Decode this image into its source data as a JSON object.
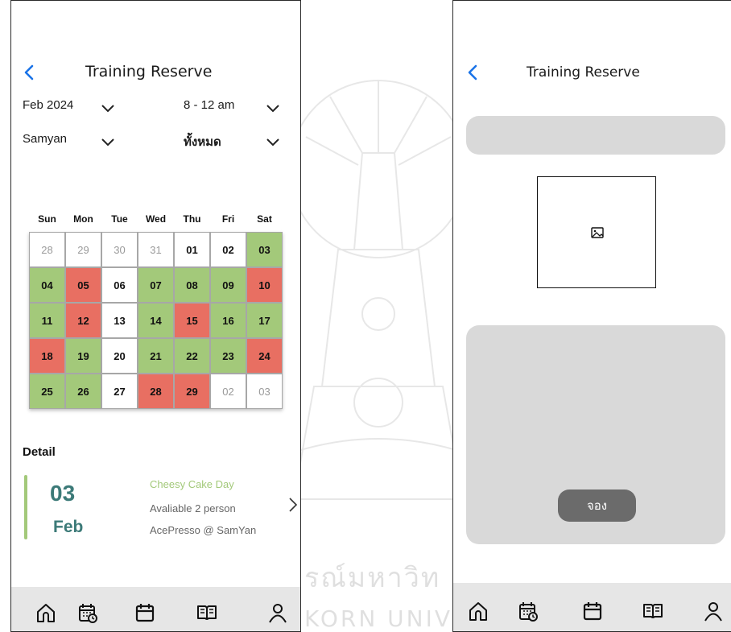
{
  "watermark": {
    "line1": "รณ์มหาวิท",
    "line2": "KORN UNIV"
  },
  "left_screen": {
    "title": "Training Reserve",
    "filters": {
      "month": "Feb 2024",
      "time": "8 - 12 am",
      "branch": "Samyan",
      "category": "ทั้งหมด"
    },
    "weekdays": [
      "Sun",
      "Mon",
      "Tue",
      "Wed",
      "Thu",
      "Fri",
      "Sat"
    ],
    "calendar_rows": [
      [
        {
          "d": "28",
          "s": "muted"
        },
        {
          "d": "29",
          "s": "muted"
        },
        {
          "d": "30",
          "s": "muted"
        },
        {
          "d": "31",
          "s": "muted"
        },
        {
          "d": "01",
          "s": "white"
        },
        {
          "d": "02",
          "s": "white"
        },
        {
          "d": "03",
          "s": "green"
        }
      ],
      [
        {
          "d": "04",
          "s": "green"
        },
        {
          "d": "05",
          "s": "red"
        },
        {
          "d": "06",
          "s": "white"
        },
        {
          "d": "07",
          "s": "green"
        },
        {
          "d": "08",
          "s": "green"
        },
        {
          "d": "09",
          "s": "green"
        },
        {
          "d": "10",
          "s": "red"
        }
      ],
      [
        {
          "d": "11",
          "s": "green"
        },
        {
          "d": "12",
          "s": "red"
        },
        {
          "d": "13",
          "s": "white"
        },
        {
          "d": "14",
          "s": "green"
        },
        {
          "d": "15",
          "s": "red"
        },
        {
          "d": "16",
          "s": "green"
        },
        {
          "d": "17",
          "s": "green"
        }
      ],
      [
        {
          "d": "18",
          "s": "red"
        },
        {
          "d": "19",
          "s": "green"
        },
        {
          "d": "20",
          "s": "white"
        },
        {
          "d": "21",
          "s": "green"
        },
        {
          "d": "22",
          "s": "green"
        },
        {
          "d": "23",
          "s": "green"
        },
        {
          "d": "24",
          "s": "red"
        }
      ],
      [
        {
          "d": "25",
          "s": "green"
        },
        {
          "d": "26",
          "s": "green"
        },
        {
          "d": "27",
          "s": "white"
        },
        {
          "d": "28",
          "s": "red"
        },
        {
          "d": "29",
          "s": "red"
        },
        {
          "d": "02",
          "s": "muted"
        },
        {
          "d": "03",
          "s": "muted"
        }
      ]
    ],
    "detail": {
      "heading": "Detail",
      "day": "03",
      "month": "Feb",
      "event": "Cheesy Cake Day",
      "availability": "Avaliable 2 person",
      "location": "AcePresso @ SamYan"
    }
  },
  "right_screen": {
    "title": "Training Reserve",
    "book_label": "จอง"
  },
  "nav_items": [
    "home-icon",
    "calendar-clock-icon",
    "calendar-icon",
    "book-icon",
    "profile-icon"
  ],
  "colors": {
    "available": "#a3c97a",
    "full": "#e86f62",
    "accent_blue": "#1a73e8",
    "detail_teal": "#3c7a78"
  }
}
